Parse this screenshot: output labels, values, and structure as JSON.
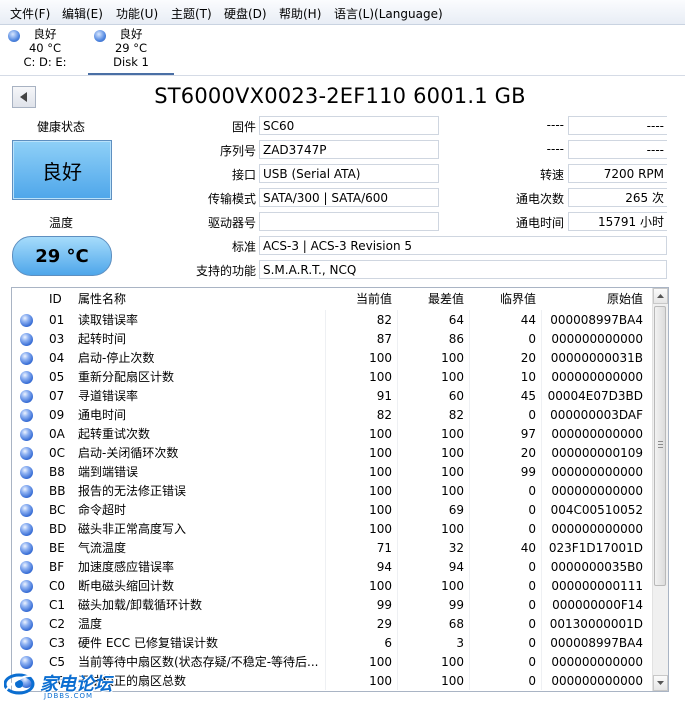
{
  "menu": [
    "文件(F)",
    "编辑(E)",
    "功能(U)",
    "主题(T)",
    "硬盘(D)",
    "帮助(H)",
    "语言(L)(Language)"
  ],
  "disks": [
    {
      "status": "良好",
      "temp": "40 °C",
      "label": "C: D: E:"
    },
    {
      "status": "良好",
      "temp": "29 °C",
      "label": "Disk 1"
    }
  ],
  "model_title": "ST6000VX0023-2EF110 6001.1 GB",
  "health": {
    "label": "健康状态",
    "value": "良好"
  },
  "temperature": {
    "label": "温度",
    "value": "29 °C"
  },
  "fields": {
    "firmware": {
      "label": "固件",
      "value": "SC60"
    },
    "serial": {
      "label": "序列号",
      "value": "ZAD3747P"
    },
    "interface": {
      "label": "接口",
      "value": "USB (Serial ATA)"
    },
    "transfer": {
      "label": "传输模式",
      "value": "SATA/300 | SATA/600"
    },
    "drive_letter": {
      "label": "驱动器号",
      "value": ""
    },
    "standard": {
      "label": "标准",
      "value": "ACS-3 | ACS-3 Revision 5"
    },
    "features": {
      "label": "支持的功能",
      "value": "S.M.A.R.T., NCQ"
    }
  },
  "right_fields": {
    "blank1": {
      "label": "----",
      "value": "----"
    },
    "blank2": {
      "label": "----",
      "value": "----"
    },
    "rpm": {
      "label": "转速",
      "value": "7200 RPM"
    },
    "power_count": {
      "label": "通电次数",
      "value": "265 次"
    },
    "power_hours": {
      "label": "通电时间",
      "value": "15791 小时"
    }
  },
  "table": {
    "headers": {
      "id": "ID",
      "name": "属性名称",
      "current": "当前值",
      "worst": "最差值",
      "threshold": "临界值",
      "raw": "原始值"
    },
    "rows": [
      {
        "id": "01",
        "name": "读取错误率",
        "current": "82",
        "worst": "64",
        "threshold": "44",
        "raw": "000008997BA4"
      },
      {
        "id": "03",
        "name": "起转时间",
        "current": "87",
        "worst": "86",
        "threshold": "0",
        "raw": "000000000000"
      },
      {
        "id": "04",
        "name": "启动-停止次数",
        "current": "100",
        "worst": "100",
        "threshold": "20",
        "raw": "00000000031B"
      },
      {
        "id": "05",
        "name": "重新分配扇区计数",
        "current": "100",
        "worst": "100",
        "threshold": "10",
        "raw": "000000000000"
      },
      {
        "id": "07",
        "name": "寻道错误率",
        "current": "91",
        "worst": "60",
        "threshold": "45",
        "raw": "00004E07D3BD"
      },
      {
        "id": "09",
        "name": "通电时间",
        "current": "82",
        "worst": "82",
        "threshold": "0",
        "raw": "000000003DAF"
      },
      {
        "id": "0A",
        "name": "起转重试次数",
        "current": "100",
        "worst": "100",
        "threshold": "97",
        "raw": "000000000000"
      },
      {
        "id": "0C",
        "name": "启动-关闭循环次数",
        "current": "100",
        "worst": "100",
        "threshold": "20",
        "raw": "000000000109"
      },
      {
        "id": "B8",
        "name": "端到端错误",
        "current": "100",
        "worst": "100",
        "threshold": "99",
        "raw": "000000000000"
      },
      {
        "id": "BB",
        "name": "报告的无法修正错误",
        "current": "100",
        "worst": "100",
        "threshold": "0",
        "raw": "000000000000"
      },
      {
        "id": "BC",
        "name": "命令超时",
        "current": "100",
        "worst": "69",
        "threshold": "0",
        "raw": "004C00510052"
      },
      {
        "id": "BD",
        "name": "磁头非正常高度写入",
        "current": "100",
        "worst": "100",
        "threshold": "0",
        "raw": "000000000000"
      },
      {
        "id": "BE",
        "name": "气流温度",
        "current": "71",
        "worst": "32",
        "threshold": "40",
        "raw": "023F1D17001D"
      },
      {
        "id": "BF",
        "name": "加速度感应错误率",
        "current": "94",
        "worst": "94",
        "threshold": "0",
        "raw": "0000000035B0"
      },
      {
        "id": "C0",
        "name": "断电磁头缩回计数",
        "current": "100",
        "worst": "100",
        "threshold": "0",
        "raw": "000000000111"
      },
      {
        "id": "C1",
        "name": "磁头加载/卸载循环计数",
        "current": "99",
        "worst": "99",
        "threshold": "0",
        "raw": "000000000F14"
      },
      {
        "id": "C2",
        "name": "温度",
        "current": "29",
        "worst": "68",
        "threshold": "0",
        "raw": "00130000001D"
      },
      {
        "id": "C3",
        "name": "硬件 ECC 已修复错误计数",
        "current": "6",
        "worst": "3",
        "threshold": "0",
        "raw": "000008997BA4"
      },
      {
        "id": "C5",
        "name": "当前等待中扇区数(状态存疑/不稳定-等待后...",
        "current": "100",
        "worst": "100",
        "threshold": "0",
        "raw": "000000000000"
      },
      {
        "id": "C6",
        "name": "无法校正的扇区总数",
        "current": "100",
        "worst": "100",
        "threshold": "0",
        "raw": "000000000000"
      }
    ]
  },
  "watermark": {
    "text": "家电论坛",
    "sub": "JDBBS.COM"
  }
}
